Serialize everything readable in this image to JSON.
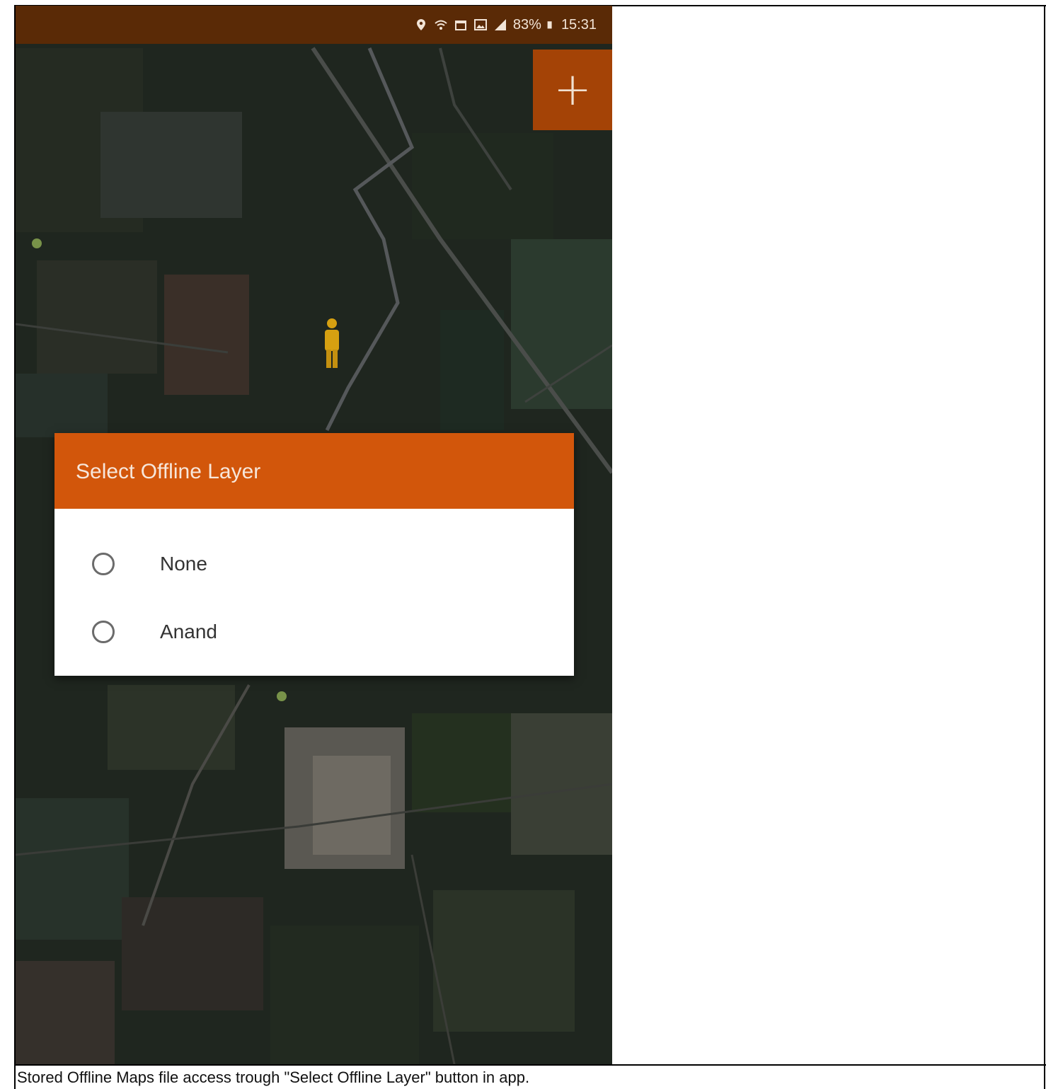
{
  "status_bar": {
    "battery": "83%",
    "time": "15:31",
    "icons": [
      "location-icon",
      "wifi-icon",
      "calendar-icon",
      "gallery-icon",
      "signal-icon",
      "battery-icon"
    ]
  },
  "fab": {
    "label": "+",
    "icon": "plus-icon"
  },
  "dialog": {
    "title": "Select Offline Layer",
    "options": [
      {
        "label": "None",
        "selected": false
      },
      {
        "label": "Anand",
        "selected": false
      }
    ]
  },
  "caption": "Stored  Offline Maps file access trough \"Select Offline Layer\" button in app.",
  "colors": {
    "status_bar": "#5a2a06",
    "fab": "#a44306",
    "dialog_header": "#d2560b",
    "user_marker": "#d6a011"
  }
}
